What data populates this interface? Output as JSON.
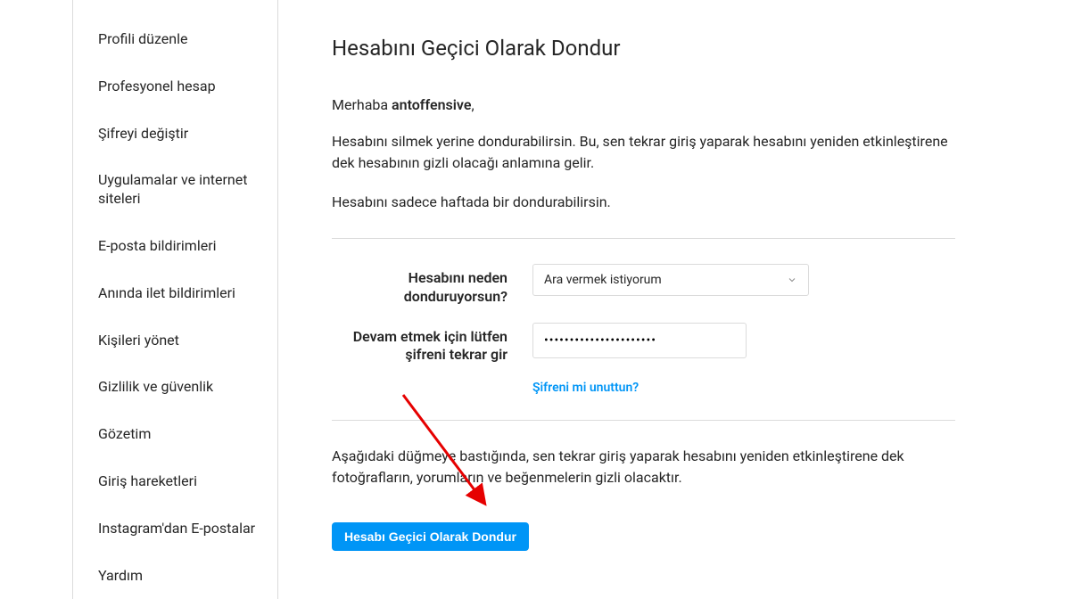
{
  "sidebar": {
    "items": [
      {
        "label": "Profili düzenle"
      },
      {
        "label": "Profesyonel hesap"
      },
      {
        "label": "Şifreyi değiştir"
      },
      {
        "label": "Uygulamalar ve internet siteleri"
      },
      {
        "label": "E-posta bildirimleri"
      },
      {
        "label": "Anında ilet bildirimleri"
      },
      {
        "label": "Kişileri yönet"
      },
      {
        "label": "Gizlilik ve güvenlik"
      },
      {
        "label": "Gözetim"
      },
      {
        "label": "Giriş hareketleri"
      },
      {
        "label": "Instagram'dan E-postalar"
      },
      {
        "label": "Yardım"
      }
    ]
  },
  "main": {
    "title": "Hesabını Geçici Olarak Dondur",
    "greeting_prefix": "Merhaba ",
    "username": "antoffensive",
    "greeting_suffix": ",",
    "desc1": "Hesabını silmek yerine dondurabilirsin. Bu, sen tekrar giriş yaparak hesabını yeniden etkinleştirene dek hesabının gizli olacağı anlamına gelir.",
    "desc2": "Hesabını sadece haftada bir dondurabilirsin.",
    "reason_label": "Hesabını neden donduruyorsun?",
    "reason_value": "Ara vermek istiyorum",
    "password_label": "Devam etmek için lütfen şifreni tekrar gir",
    "password_value": "••••••••••••••••••••••",
    "forgot_link": "Şifreni mi unuttun?",
    "bottom_desc": "Aşağıdaki düğmeye bastığında, sen tekrar giriş yaparak hesabını yeniden etkinleştirene dek fotoğrafların, yorumların ve beğenmelerin gizli olacaktır.",
    "submit_label": "Hesabı Geçici Olarak Dondur"
  }
}
